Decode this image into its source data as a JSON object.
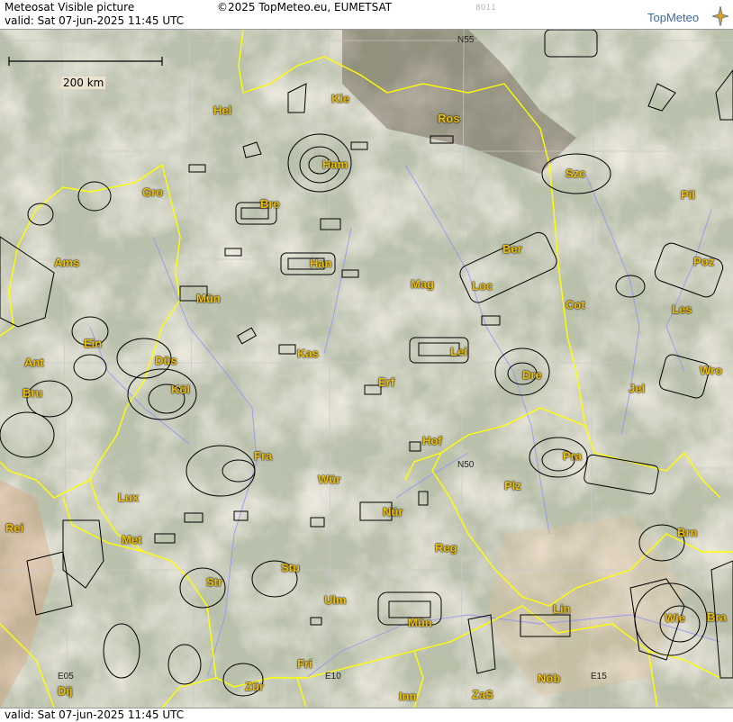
{
  "header": {
    "title": "Meteosat Visible picture",
    "valid": "valid:  Sat  07-jun-2025  11:45 UTC",
    "copyright": "©2025 TopMeteo.eu, EUMETSAT",
    "code": "8011",
    "logo": "TopMeteo"
  },
  "footer": {
    "valid": "valid:  Sat  07-jun-2025  11:45 UTC"
  },
  "scale": {
    "label": "200 km"
  },
  "grid_labels": [
    "N55",
    "N50",
    "E05",
    "E10",
    "E15"
  ],
  "colors": {
    "city": "#f0c000",
    "border": "#ffff00",
    "rivers": "#8c8cff",
    "airspace": "#000000",
    "grid": "#c8c8c8"
  },
  "cities": [
    {
      "name": "Hel"
    },
    {
      "name": "Kie"
    },
    {
      "name": "Ros"
    },
    {
      "name": "Ham"
    },
    {
      "name": "Szc"
    },
    {
      "name": "Gro"
    },
    {
      "name": "Bre"
    },
    {
      "name": "Pil"
    },
    {
      "name": "Ber"
    },
    {
      "name": "Ams"
    },
    {
      "name": "Han"
    },
    {
      "name": "Poz"
    },
    {
      "name": "Mag"
    },
    {
      "name": "Loc"
    },
    {
      "name": "Mün"
    },
    {
      "name": "Cot"
    },
    {
      "name": "Les"
    },
    {
      "name": "Ein"
    },
    {
      "name": "Lei"
    },
    {
      "name": "Kas"
    },
    {
      "name": "Ant"
    },
    {
      "name": "Düs"
    },
    {
      "name": "Dre"
    },
    {
      "name": "Wro"
    },
    {
      "name": "Bru"
    },
    {
      "name": "Köl"
    },
    {
      "name": "Erf"
    },
    {
      "name": "Jel"
    },
    {
      "name": "Hof"
    },
    {
      "name": "Fra"
    },
    {
      "name": "Pra"
    },
    {
      "name": "Wür"
    },
    {
      "name": "Plz"
    },
    {
      "name": "Lux"
    },
    {
      "name": "Nür"
    },
    {
      "name": "Rei"
    },
    {
      "name": "Met"
    },
    {
      "name": "Brn"
    },
    {
      "name": "Reg"
    },
    {
      "name": "Stu"
    },
    {
      "name": "Str"
    },
    {
      "name": "Ulm"
    },
    {
      "name": "Lin"
    },
    {
      "name": "Mün"
    },
    {
      "name": "Wie"
    },
    {
      "name": "Bra"
    },
    {
      "name": "Fri"
    },
    {
      "name": "Dij"
    },
    {
      "name": "Zür"
    },
    {
      "name": "Nöb"
    },
    {
      "name": "Inn"
    },
    {
      "name": "ZaS"
    }
  ]
}
